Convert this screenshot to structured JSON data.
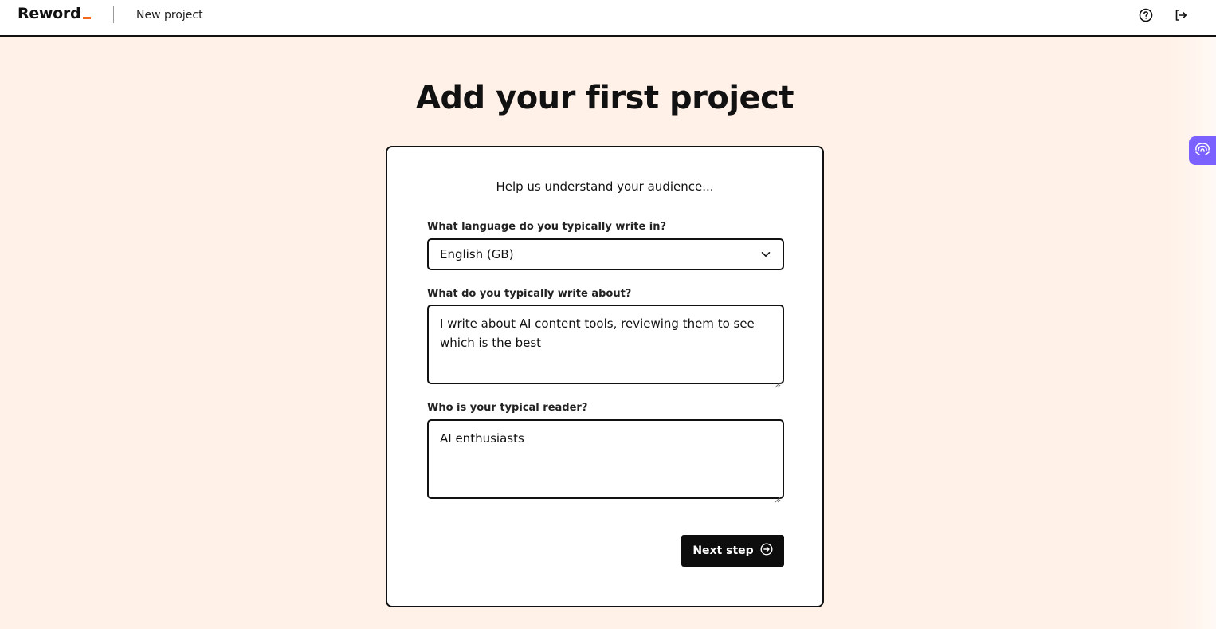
{
  "header": {
    "logo_text": "Reword",
    "breadcrumb": "New project",
    "help_icon": "question-circle-icon",
    "logout_icon": "logout-icon"
  },
  "side_tab": {
    "icon": "brain-icon",
    "color": "#7b61ff"
  },
  "main": {
    "title": "Add your first project",
    "subtitle": "Help us understand your audience...",
    "language": {
      "label": "What language do you typically write in?",
      "value": "English (GB)"
    },
    "about": {
      "label": "What do you typically write about?",
      "value": "I write about AI content tools, reviewing them to see which is the best"
    },
    "reader": {
      "label": "Who is your typical reader?",
      "value": "AI enthusiasts"
    },
    "next_button": "Next step"
  },
  "colors": {
    "background": "#fff1e7",
    "accent": "#f26a1b",
    "button": "#0d0d0d"
  }
}
